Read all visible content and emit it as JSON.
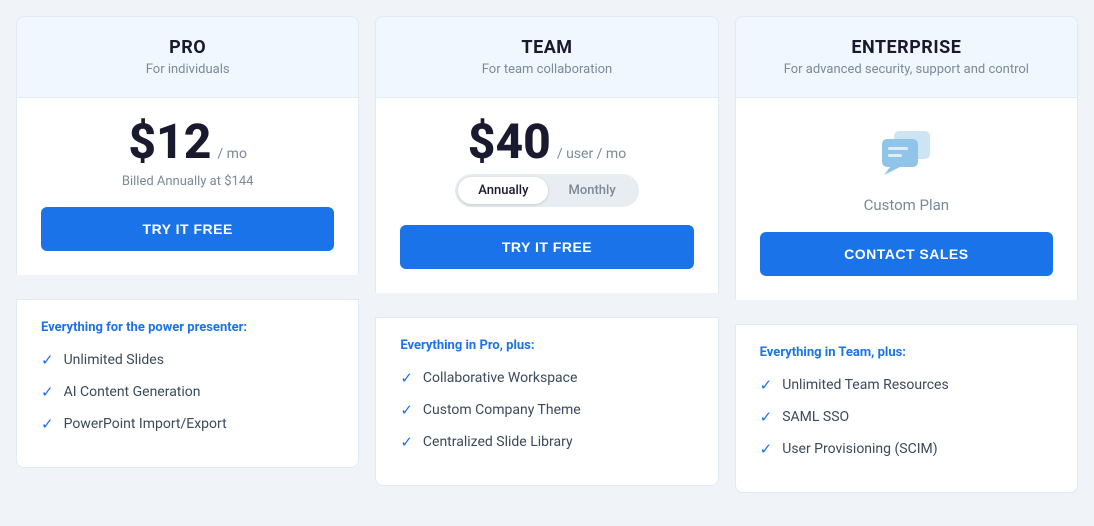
{
  "plans": [
    {
      "id": "pro",
      "name": "PRO",
      "subtitle": "For individuals",
      "price": "$12",
      "price_unit": "/ mo",
      "billed_note": "Billed Annually at $144",
      "cta_label": "TRY IT FREE",
      "cta_type": "primary",
      "features_heading": "Everything for the power presenter:",
      "features": [
        "Unlimited Slides",
        "AI Content Generation",
        "PowerPoint Import/Export"
      ]
    },
    {
      "id": "team",
      "name": "TEAM",
      "subtitle": "For team collaboration",
      "price": "$40",
      "price_unit": "/ user / mo",
      "toggle": {
        "option1": "Annually",
        "option2": "Monthly",
        "active": "Annually"
      },
      "cta_label": "TRY IT FREE",
      "cta_type": "primary",
      "features_heading": "Everything in Pro, plus:",
      "features": [
        "Collaborative Workspace",
        "Custom Company Theme",
        "Centralized Slide Library"
      ]
    },
    {
      "id": "enterprise",
      "name": "ENTERPRISE",
      "subtitle": "For advanced security, support and control",
      "custom_plan_label": "Custom Plan",
      "cta_label": "CONTACT SALES",
      "cta_type": "primary",
      "features_heading": "Everything in Team, plus:",
      "features": [
        "Unlimited Team Resources",
        "SAML SSO",
        "User Provisioning (SCIM)"
      ]
    }
  ],
  "colors": {
    "accent": "#1a73e8",
    "text_dark": "#1a1a2e",
    "text_muted": "#7a8a99",
    "text_feature": "#3a4a5a",
    "bg_header": "#f0f7ff",
    "border": "#e2eaf2"
  }
}
